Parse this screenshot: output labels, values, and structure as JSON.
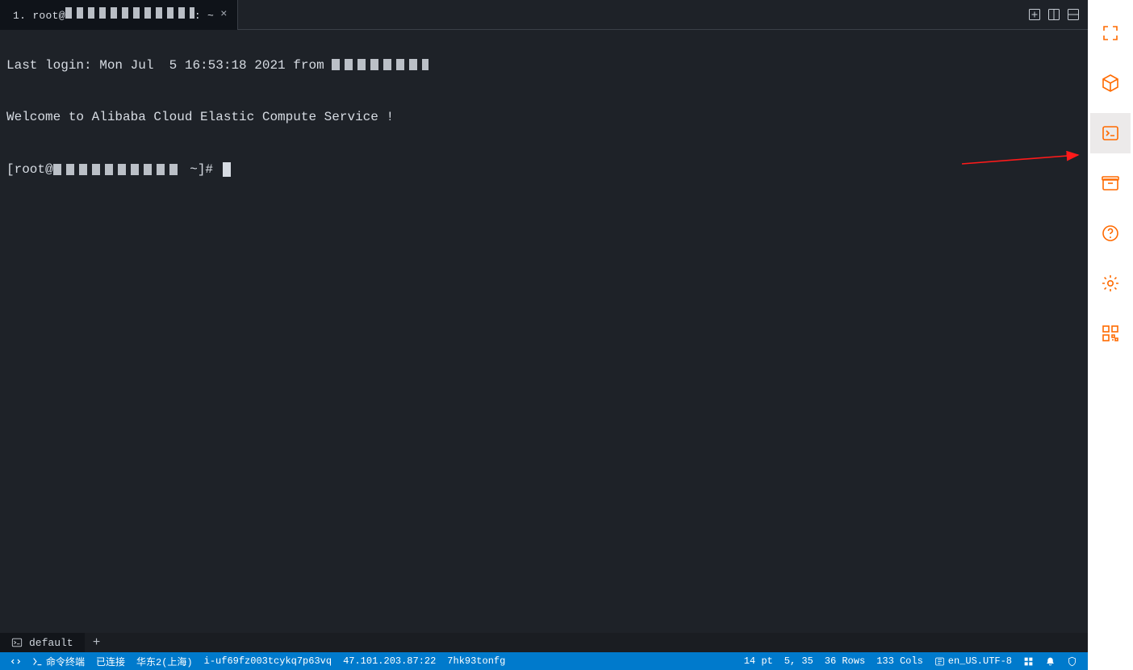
{
  "tab": {
    "index": "1.",
    "user": "root@",
    "host_masked": true,
    "suffix": ": ~"
  },
  "terminal": {
    "line1_prefix": "Last login: Mon Jul  5 16:53:18 2021 from ",
    "line1_masked_tail": true,
    "line2_blank": "",
    "line3": "Welcome to Alibaba Cloud Elastic Compute Service !",
    "line4_blank": "",
    "prompt_prefix": "[root@",
    "prompt_host_masked": true,
    "prompt_suffix": " ~]# "
  },
  "bottombar1": {
    "session_label": "default"
  },
  "bottombar2": {
    "terminal_label": "命令终端",
    "conn_status": "已连接",
    "region": "华东2(上海)",
    "instance_id": "i-uf69fz003tcykq7p63vq",
    "ip": "47.101.203.87:22",
    "short_id": "7hk93tonfg",
    "font_size": "14 pt",
    "cursor_pos": "5, 35",
    "rows": "36 Rows",
    "cols": "133 Cols",
    "encoding": "en_US.UTF-8"
  },
  "sidebar": {
    "items": [
      "fullscreen",
      "cube",
      "terminal",
      "archive",
      "help",
      "settings",
      "qrcode"
    ]
  },
  "colors": {
    "accent": "#ff6a00",
    "blue": "#007acc",
    "panel": "#1e2228"
  }
}
